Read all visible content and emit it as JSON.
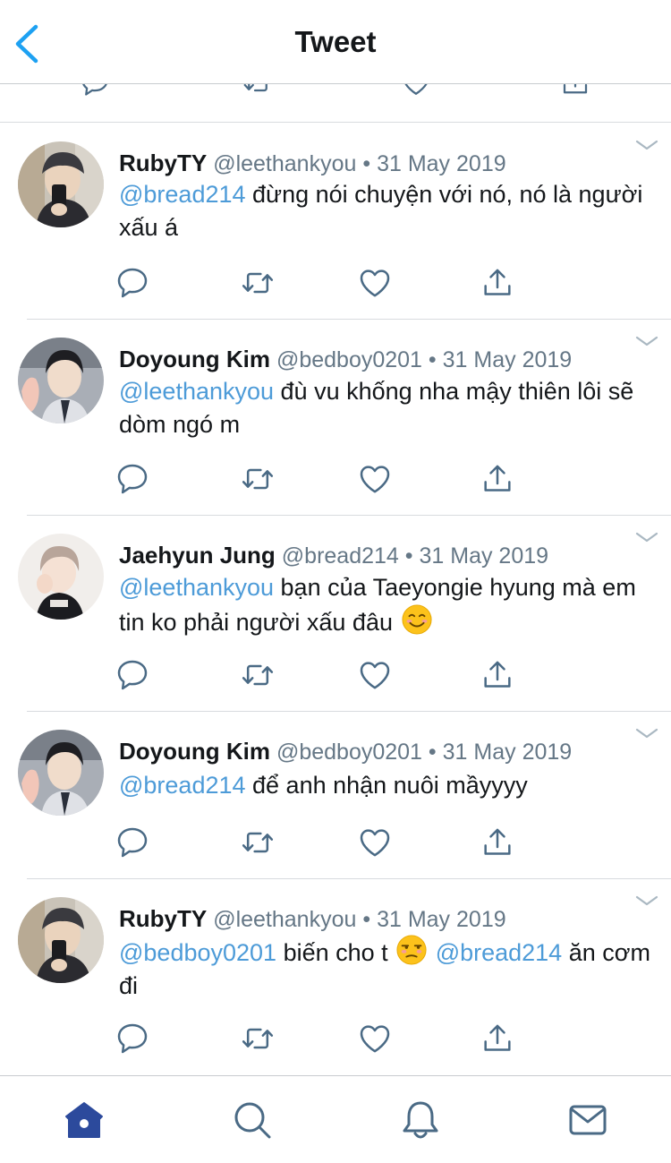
{
  "header": {
    "title": "Tweet",
    "back_icon": "chevron-left-icon",
    "accent": "#1da1f2"
  },
  "colors": {
    "mention": "#4d9bd8",
    "muted": "#657786",
    "icon": "#4a6a85",
    "home_active": "#2c4a9c"
  },
  "tweets": [
    {
      "name": "RubyTY",
      "handle": "@leethankyou",
      "dot": "•",
      "date": "31 May 2019",
      "mention": "@bread214",
      "text": " đừng nói chuyện với nó, nó là người xấu á"
    },
    {
      "name": "Doyoung Kim",
      "handle": "@bedboy0201",
      "dot": "•",
      "date": "31 May 2019",
      "mention": "@leethankyou",
      "text": " đù vu khống nha mậy thiên lôi sẽ dòm ngó m"
    },
    {
      "name": "Jaehyun Jung",
      "handle": "@bread214",
      "dot": "•",
      "date": "31 May 2019",
      "mention": "@leethankyou",
      "text": " bạn của Taeyongie hyung mà em tin ko phải người xấu đâu",
      "emoji": "smiling-face-emoji"
    },
    {
      "name": "Doyoung Kim",
      "handle": "@bedboy0201",
      "dot": "•",
      "date": "31 May 2019",
      "mention": "@bread214",
      "text": " để anh nhận nuôi mầyyyy"
    },
    {
      "name": "RubyTY",
      "handle": "@leethankyou",
      "dot": "•",
      "date": "31 May 2019",
      "mention": "@bedboy0201",
      "text": " biến cho t",
      "emoji": "unamused-face-emoji",
      "mention2": "@bread214",
      "text2": " ăn cơm đi"
    }
  ],
  "actions": [
    "reply-icon",
    "retweet-icon",
    "like-icon",
    "share-icon"
  ],
  "tabbar": [
    "home-icon",
    "search-icon",
    "notifications-icon",
    "messages-icon"
  ]
}
